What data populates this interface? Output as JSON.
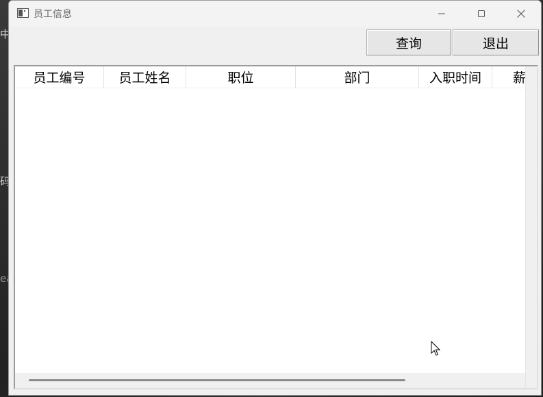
{
  "desktop": {
    "fragments": [
      "中",
      "码",
      "ea"
    ]
  },
  "window": {
    "title": "员工信息",
    "controls": {
      "minimize": "minimize-icon",
      "maximize": "maximize-icon",
      "close": "close-icon"
    }
  },
  "toolbar": {
    "query_label": "查询",
    "exit_label": "退出"
  },
  "table": {
    "columns": [
      "员工编号",
      "员工姓名",
      "职位",
      "部门",
      "入职时间",
      "薪"
    ],
    "rows": []
  }
}
